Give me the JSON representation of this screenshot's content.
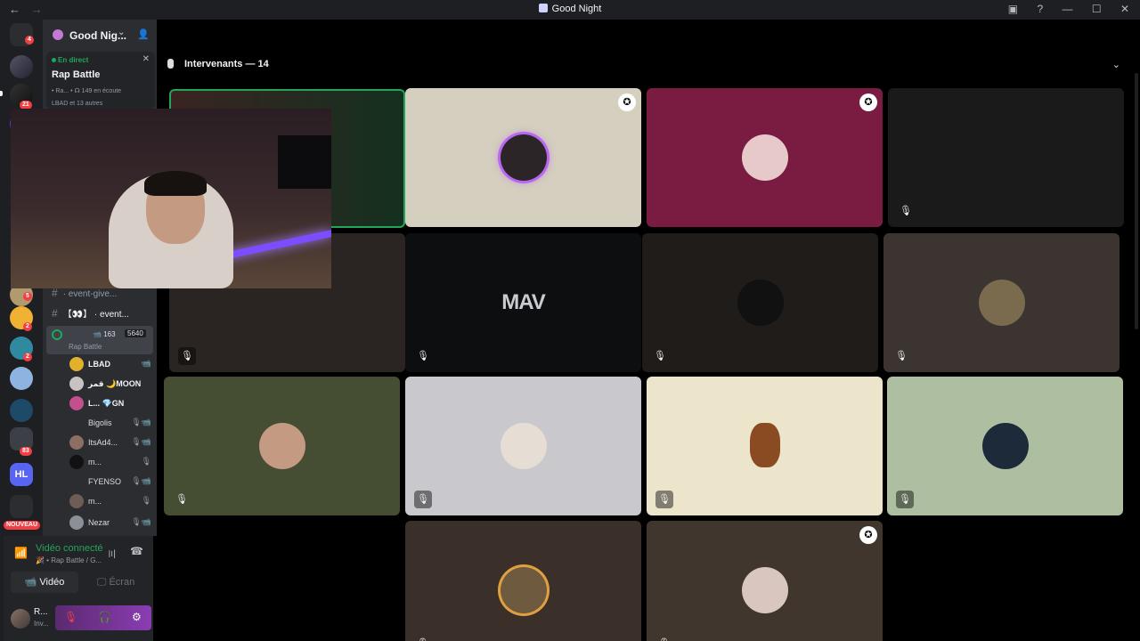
{
  "titlebar": {
    "title": "Good Night",
    "back": "←",
    "forward": "→"
  },
  "rail": {
    "badges": {
      "home": "4",
      "g2": "21",
      "g8": "5",
      "g9": "2",
      "g10": "2",
      "g13": "83"
    },
    "new_label": "NOUVEAU",
    "hl_label": "HL"
  },
  "server": {
    "name": "Good Nig..."
  },
  "live": {
    "status": "En direct",
    "stage_name": "Rap Battle",
    "meta": "• Ra...  • ☊ 149 en écoute",
    "meta2": "LBAD et 13 autres"
  },
  "channels": [
    {
      "label": "· event-give..."
    },
    {
      "label": "【👀】 · event..."
    }
  ],
  "stage_row": {
    "video_count": "163",
    "listeners": "5640",
    "label": "Rap Battle"
  },
  "members": [
    {
      "name": "LBAD",
      "icon": "📹"
    },
    {
      "name": "قمر 🌙MOON",
      "icon": ""
    },
    {
      "name": "L... 💎GN",
      "icon": ""
    },
    {
      "name": "Bigolis",
      "icon": "🎙📹"
    },
    {
      "name": "ItsAd4...",
      "icon": "🎙📹"
    },
    {
      "name": "m...",
      "icon": "🎙"
    },
    {
      "name": "FYENSO",
      "icon": "🎙📹"
    },
    {
      "name": "m...",
      "icon": "🎙"
    },
    {
      "name": "Nezar",
      "icon": "🎙📹"
    }
  ],
  "voice": {
    "status": "Vidéo connecté",
    "sub": "🎉 • Rap Battle / G...",
    "video_label": "Vidéo",
    "screen_label": "Écran"
  },
  "user": {
    "name": "R...",
    "status": "Inv..."
  },
  "stage": {
    "speakers_header": "Intervenants — 14",
    "tiles": [
      {
        "bg": "#d4cfbe",
        "shield": true,
        "mute": false
      },
      {
        "bg": "#7a1c42",
        "shield": true,
        "mute": false
      },
      {
        "bg": "#1a1a1a",
        "shield": false,
        "mute": true
      },
      {
        "bg": "#0d0e10",
        "logo": "MAV",
        "mute": true
      },
      {
        "bg": "#1f1c1a",
        "mute": true
      },
      {
        "bg": "#3b3430",
        "mute": true
      },
      {
        "bg": "#454d33",
        "mute": true
      },
      {
        "bg": "#c9c8cd",
        "mute": true
      },
      {
        "bg": "#ece5cb",
        "mute": true
      },
      {
        "bg": "#adbfa0",
        "mute": true
      },
      {
        "bg": "#3a3029",
        "mute": true
      },
      {
        "bg": "#40362d",
        "shield": true,
        "mute": true
      }
    ]
  }
}
